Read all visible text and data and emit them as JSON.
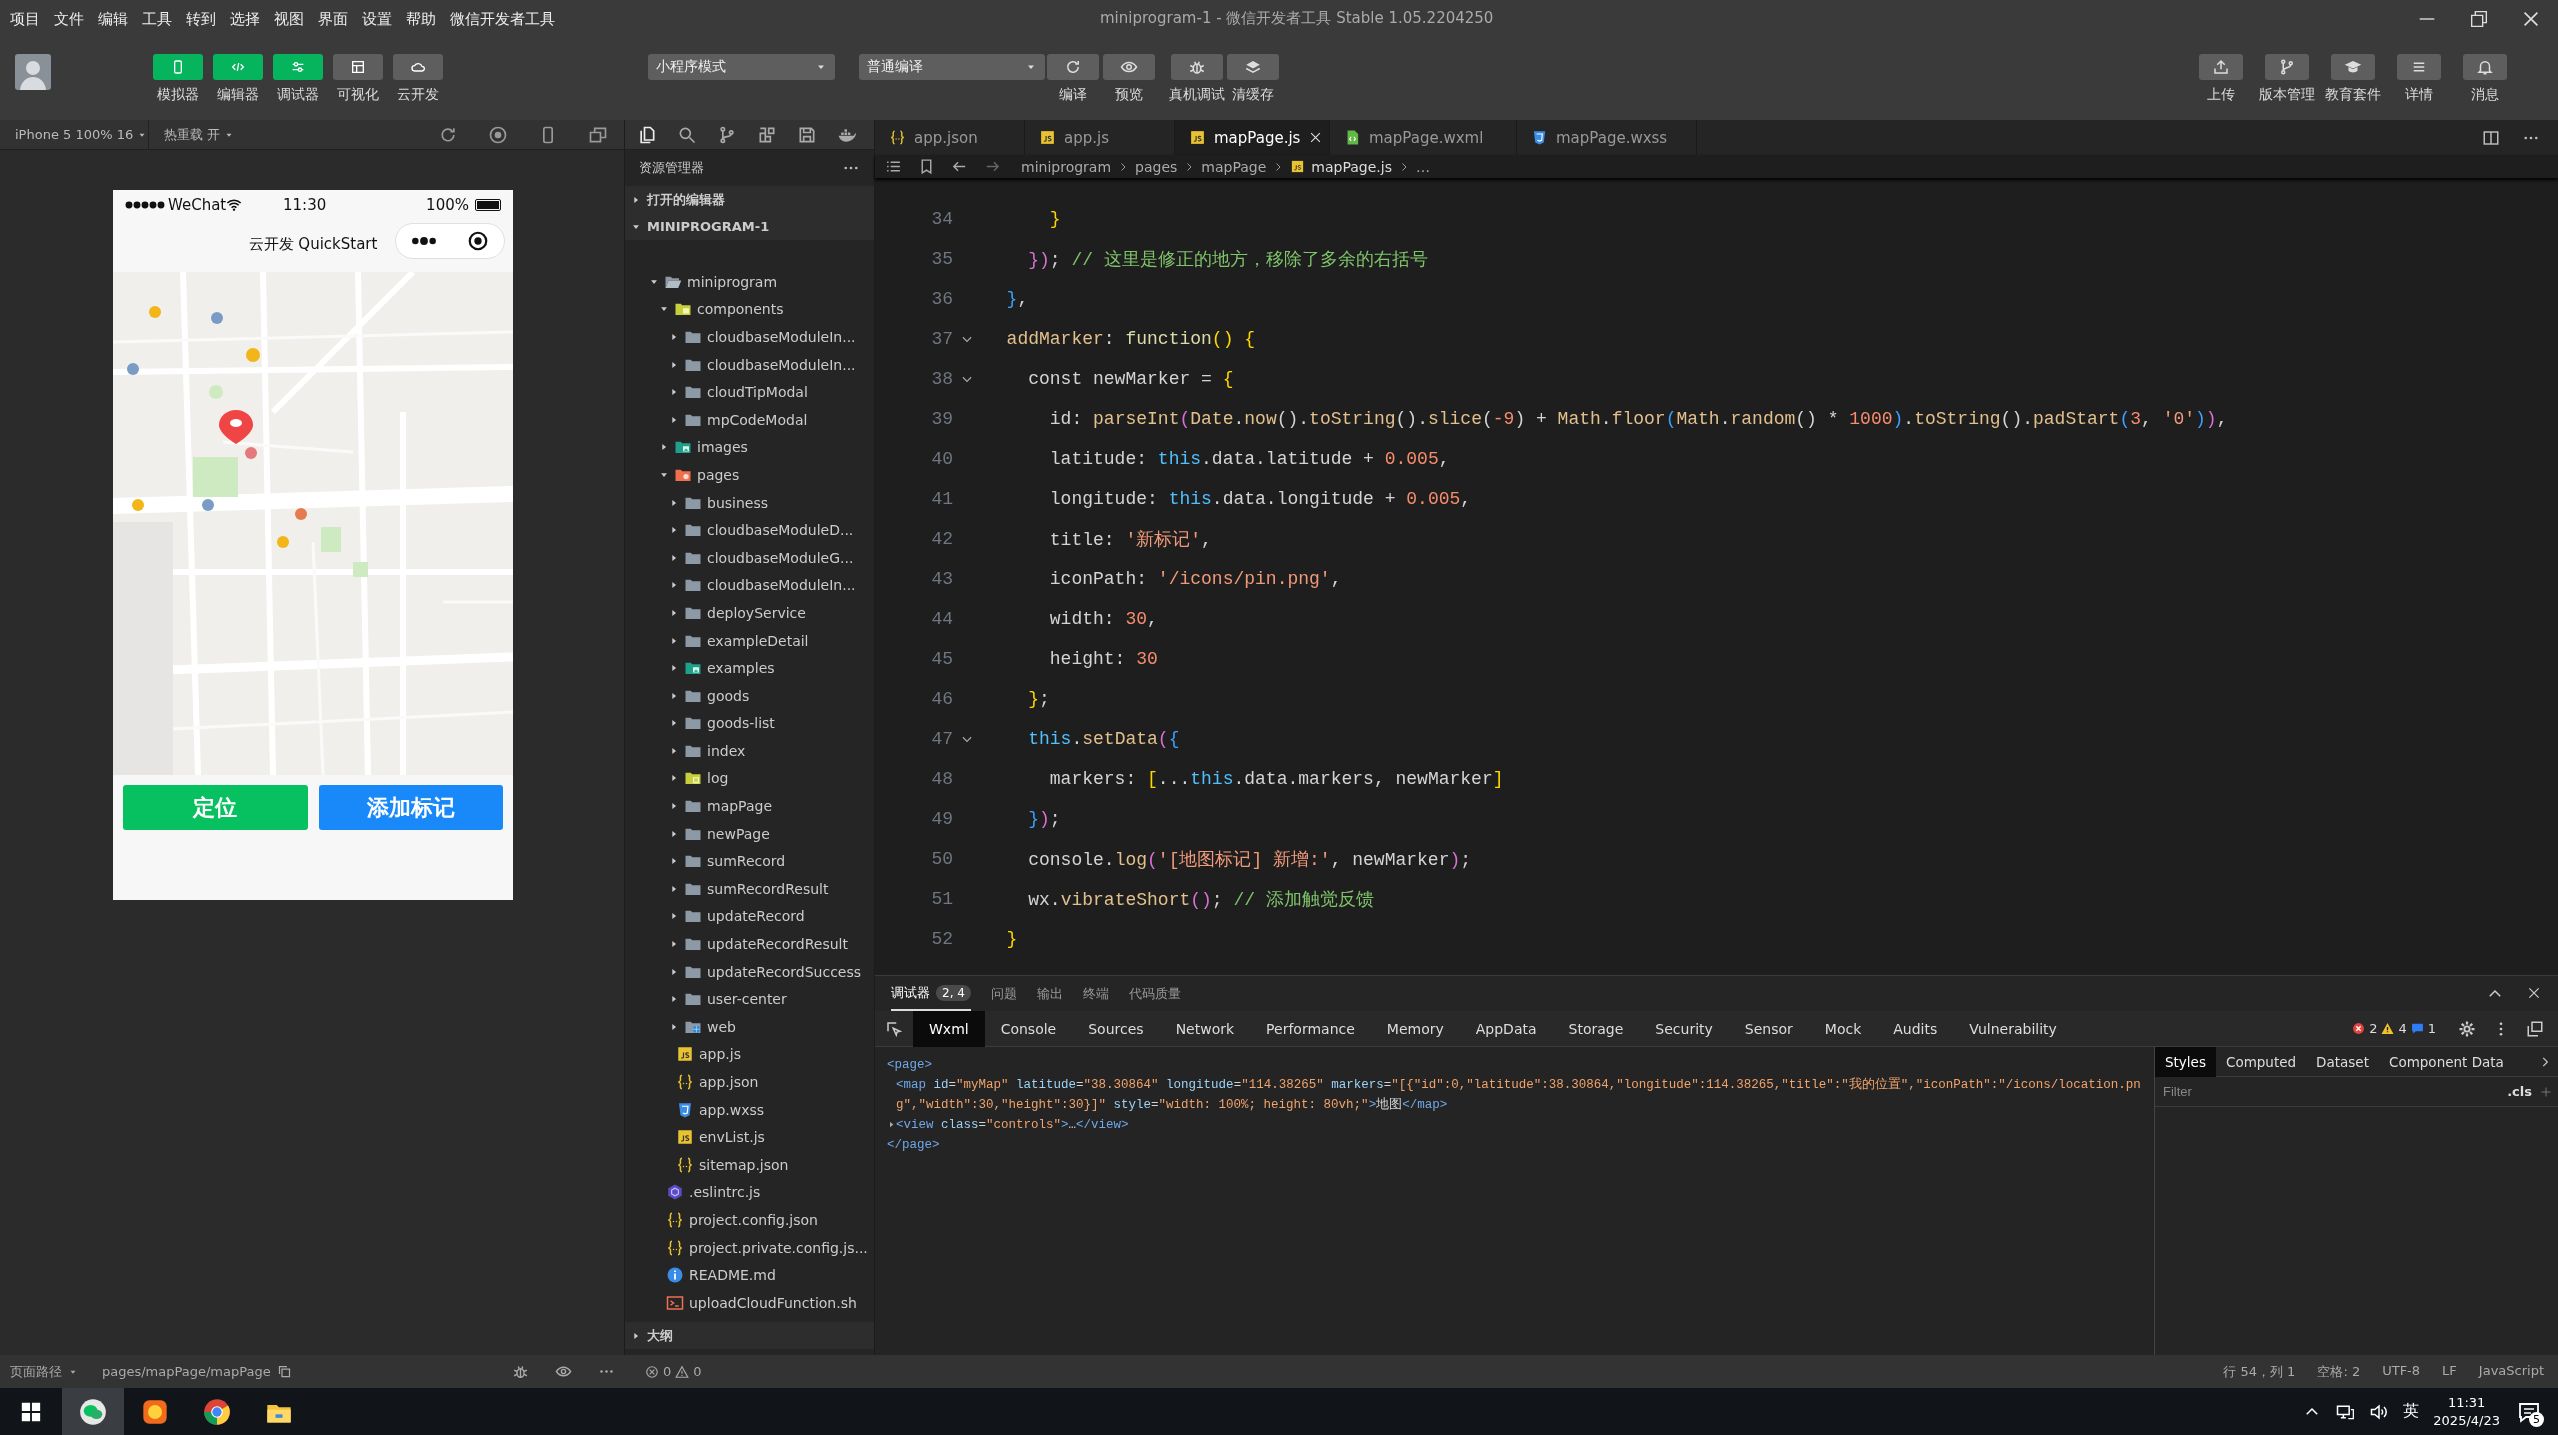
{
  "menu": [
    "项目",
    "文件",
    "编辑",
    "工具",
    "转到",
    "选择",
    "视图",
    "界面",
    "设置",
    "帮助",
    "微信开发者工具"
  ],
  "window": {
    "title": "miniprogram-1 - 微信开发者工具 Stable 1.05.2204250"
  },
  "toolbar": {
    "views": [
      {
        "label": "模拟器",
        "on": true
      },
      {
        "label": "编辑器",
        "on": true
      },
      {
        "label": "调试器",
        "on": true
      },
      {
        "label": "可视化",
        "on": false
      },
      {
        "label": "云开发",
        "on": false
      }
    ],
    "mode_select": "小程序模式",
    "compile_select": "普通编译",
    "actions": [
      {
        "label": "编译"
      },
      {
        "label": "预览"
      },
      {
        "label": "真机调试"
      },
      {
        "label": "清缓存"
      }
    ],
    "right_actions": [
      {
        "label": "上传"
      },
      {
        "label": "版本管理"
      },
      {
        "label": "教育套件"
      },
      {
        "label": "详情"
      },
      {
        "label": "消息"
      }
    ]
  },
  "simulator": {
    "device": "iPhone 5 100% 16",
    "hot_reload": "热重载 开",
    "phone": {
      "carrier": "WeChat",
      "time": "11:30",
      "battery": "100%",
      "nav_title": "云开发 QuickStart",
      "buttons": [
        {
          "label": "定位",
          "color": "#07c160"
        },
        {
          "label": "添加标记",
          "color": "#1989fa"
        }
      ]
    }
  },
  "explorer": {
    "title": "资源管理器",
    "open_editors": {
      "label": "打开的编辑器",
      "expanded": false
    },
    "project": {
      "label": "MINIPROGRAM-1",
      "expanded": true,
      "children": [
        {
          "name": "miniprogram",
          "kind": "folder-open",
          "expanded": true,
          "children": [
            {
              "name": "components",
              "kind": "folder-components",
              "expanded": true,
              "children": [
                {
                  "name": "cloudbaseModuleIn...",
                  "kind": "folder",
                  "expanded": false
                },
                {
                  "name": "cloudbaseModuleIn...",
                  "kind": "folder",
                  "expanded": false
                },
                {
                  "name": "cloudTipModal",
                  "kind": "folder",
                  "expanded": false
                },
                {
                  "name": "mpCodeModal",
                  "kind": "folder",
                  "expanded": false
                }
              ]
            },
            {
              "name": "images",
              "kind": "folder-images",
              "expanded": false
            },
            {
              "name": "pages",
              "kind": "folder-pages",
              "expanded": true,
              "children": [
                {
                  "name": "business",
                  "kind": "folder",
                  "expanded": false
                },
                {
                  "name": "cloudbaseModuleD...",
                  "kind": "folder",
                  "expanded": false
                },
                {
                  "name": "cloudbaseModuleG...",
                  "kind": "folder",
                  "expanded": false
                },
                {
                  "name": "cloudbaseModuleIn...",
                  "kind": "folder",
                  "expanded": false
                },
                {
                  "name": "deployService",
                  "kind": "folder",
                  "expanded": false
                },
                {
                  "name": "exampleDetail",
                  "kind": "folder",
                  "expanded": false
                },
                {
                  "name": "examples",
                  "kind": "folder-images",
                  "expanded": false
                },
                {
                  "name": "goods",
                  "kind": "folder",
                  "expanded": false
                },
                {
                  "name": "goods-list",
                  "kind": "folder",
                  "expanded": false
                },
                {
                  "name": "index",
                  "kind": "folder",
                  "expanded": false
                },
                {
                  "name": "log",
                  "kind": "folder-log",
                  "expanded": false
                },
                {
                  "name": "mapPage",
                  "kind": "folder",
                  "expanded": false
                },
                {
                  "name": "newPage",
                  "kind": "folder",
                  "expanded": false
                },
                {
                  "name": "sumRecord",
                  "kind": "folder",
                  "expanded": false
                },
                {
                  "name": "sumRecordResult",
                  "kind": "folder",
                  "expanded": false
                },
                {
                  "name": "updateRecord",
                  "kind": "folder",
                  "expanded": false
                },
                {
                  "name": "updateRecordResult",
                  "kind": "folder",
                  "expanded": false
                },
                {
                  "name": "updateRecordSuccess",
                  "kind": "folder",
                  "expanded": false
                },
                {
                  "name": "user-center",
                  "kind": "folder",
                  "expanded": false
                },
                {
                  "name": "web",
                  "kind": "folder-web",
                  "expanded": false
                }
              ]
            },
            {
              "name": "app.js",
              "kind": "js"
            },
            {
              "name": "app.json",
              "kind": "json"
            },
            {
              "name": "app.wxss",
              "kind": "wxss"
            },
            {
              "name": "envList.js",
              "kind": "js"
            },
            {
              "name": "sitemap.json",
              "kind": "json"
            }
          ]
        },
        {
          "name": ".eslintrc.js",
          "kind": "eslint"
        },
        {
          "name": "project.config.json",
          "kind": "json"
        },
        {
          "name": "project.private.config.js...",
          "kind": "json"
        },
        {
          "name": "README.md",
          "kind": "info"
        },
        {
          "name": "uploadCloudFunction.sh",
          "kind": "terminal"
        }
      ]
    },
    "outline": {
      "label": "大纲",
      "expanded": false
    }
  },
  "editor": {
    "tabs": [
      {
        "label": "app.json",
        "kind": "json",
        "selected": false
      },
      {
        "label": "app.js",
        "kind": "js",
        "selected": false
      },
      {
        "label": "mapPage.js",
        "kind": "js",
        "selected": true
      },
      {
        "label": "mapPage.wxml",
        "kind": "wxml",
        "selected": false
      },
      {
        "label": "mapPage.wxss",
        "kind": "wxss",
        "selected": false
      }
    ],
    "breadcrumb": [
      {
        "label": "miniprogram",
        "kind": "folder"
      },
      {
        "label": "pages",
        "kind": "folder"
      },
      {
        "label": "mapPage",
        "kind": "folder"
      },
      {
        "label": "mapPage.js",
        "kind": "js"
      },
      {
        "label": "…",
        "kind": "symbol"
      }
    ],
    "lines": [
      {
        "number": "34",
        "fold": false,
        "tokens": [
          {
            "text": "      }",
            "kind": "b1"
          }
        ]
      },
      {
        "number": "35",
        "fold": false,
        "tokens": [
          {
            "text": "    })",
            "kind": "b2"
          },
          {
            "text": "; ",
            "kind": "p"
          },
          {
            "text": "// 这里是修正的地方，移除了多余的右括号",
            "kind": "c"
          }
        ]
      },
      {
        "number": "36",
        "fold": false,
        "tokens": [
          {
            "text": "  }",
            "kind": "b3"
          },
          {
            "text": ",",
            "kind": "p"
          }
        ]
      },
      {
        "number": "37",
        "fold": true,
        "tokens": [
          {
            "text": "  addMarker",
            "kind": "f"
          },
          {
            "text": ": ",
            "kind": "p"
          },
          {
            "text": "function",
            "kind": "k"
          },
          {
            "text": "() {",
            "kind": "b1"
          }
        ]
      },
      {
        "number": "38",
        "fold": true,
        "tokens": [
          {
            "text": "    const newMarker = ",
            "kind": "p"
          },
          {
            "text": "{",
            "kind": "b1"
          }
        ]
      },
      {
        "number": "39",
        "fold": false,
        "tokens": [
          {
            "text": "      id: ",
            "kind": "p"
          },
          {
            "text": "parseInt",
            "kind": "f"
          },
          {
            "text": "(",
            "kind": "b2"
          },
          {
            "text": "Date",
            "kind": "f"
          },
          {
            "text": ".",
            "kind": "p"
          },
          {
            "text": "now",
            "kind": "f"
          },
          {
            "text": "().",
            "kind": "p"
          },
          {
            "text": "toString",
            "kind": "f"
          },
          {
            "text": "().",
            "kind": "p"
          },
          {
            "text": "slice",
            "kind": "f"
          },
          {
            "text": "(",
            "kind": "p"
          },
          {
            "text": "-9",
            "kind": "n"
          },
          {
            "text": ") + ",
            "kind": "p"
          },
          {
            "text": "Math",
            "kind": "f"
          },
          {
            "text": ".",
            "kind": "p"
          },
          {
            "text": "floor",
            "kind": "f"
          },
          {
            "text": "(",
            "kind": "b3"
          },
          {
            "text": "Math",
            "kind": "f"
          },
          {
            "text": ".",
            "kind": "p"
          },
          {
            "text": "random",
            "kind": "f"
          },
          {
            "text": "() * ",
            "kind": "p"
          },
          {
            "text": "1000",
            "kind": "n"
          },
          {
            "text": ")",
            "kind": "b3"
          },
          {
            "text": ".",
            "kind": "p"
          },
          {
            "text": "toString",
            "kind": "f"
          },
          {
            "text": "().",
            "kind": "p"
          },
          {
            "text": "padStart",
            "kind": "f"
          },
          {
            "text": "(",
            "kind": "b3"
          },
          {
            "text": "3",
            "kind": "n"
          },
          {
            "text": ", ",
            "kind": "p"
          },
          {
            "text": "'0'",
            "kind": "s"
          },
          {
            "text": ")",
            "kind": "b3"
          },
          {
            "text": ")",
            "kind": "b2"
          },
          {
            "text": ",",
            "kind": "p"
          }
        ]
      },
      {
        "number": "40",
        "fold": false,
        "tokens": [
          {
            "text": "      latitude: ",
            "kind": "p"
          },
          {
            "text": "this",
            "kind": "t"
          },
          {
            "text": ".data.latitude + ",
            "kind": "p"
          },
          {
            "text": "0.005",
            "kind": "n"
          },
          {
            "text": ",",
            "kind": "p"
          }
        ]
      },
      {
        "number": "41",
        "fold": false,
        "tokens": [
          {
            "text": "      longitude: ",
            "kind": "p"
          },
          {
            "text": "this",
            "kind": "t"
          },
          {
            "text": ".data.longitude + ",
            "kind": "p"
          },
          {
            "text": "0.005",
            "kind": "n"
          },
          {
            "text": ",",
            "kind": "p"
          }
        ]
      },
      {
        "number": "42",
        "fold": false,
        "tokens": [
          {
            "text": "      title: ",
            "kind": "p"
          },
          {
            "text": "'新标记'",
            "kind": "s"
          },
          {
            "text": ",",
            "kind": "p"
          }
        ]
      },
      {
        "number": "43",
        "fold": false,
        "tokens": [
          {
            "text": "      iconPath: ",
            "kind": "p"
          },
          {
            "text": "'/icons/pin.png'",
            "kind": "s"
          },
          {
            "text": ",",
            "kind": "p"
          }
        ]
      },
      {
        "number": "44",
        "fold": false,
        "tokens": [
          {
            "text": "      width: ",
            "kind": "p"
          },
          {
            "text": "30",
            "kind": "n"
          },
          {
            "text": ",",
            "kind": "p"
          }
        ]
      },
      {
        "number": "45",
        "fold": false,
        "tokens": [
          {
            "text": "      height: ",
            "kind": "p"
          },
          {
            "text": "30",
            "kind": "n"
          }
        ]
      },
      {
        "number": "46",
        "fold": false,
        "tokens": [
          {
            "text": "    }",
            "kind": "b1"
          },
          {
            "text": ";",
            "kind": "p"
          }
        ]
      },
      {
        "number": "47",
        "fold": true,
        "tokens": [
          {
            "text": "    this",
            "kind": "t"
          },
          {
            "text": ".",
            "kind": "p"
          },
          {
            "text": "setData",
            "kind": "f"
          },
          {
            "text": "(",
            "kind": "b2"
          },
          {
            "text": "{",
            "kind": "b3"
          }
        ]
      },
      {
        "number": "48",
        "fold": false,
        "tokens": [
          {
            "text": "      markers: ",
            "kind": "p"
          },
          {
            "text": "[",
            "kind": "b1"
          },
          {
            "text": "...",
            "kind": "p"
          },
          {
            "text": "this",
            "kind": "t"
          },
          {
            "text": ".data.markers, newMarker",
            "kind": "p"
          },
          {
            "text": "]",
            "kind": "b1"
          }
        ]
      },
      {
        "number": "49",
        "fold": false,
        "tokens": [
          {
            "text": "    }",
            "kind": "b3"
          },
          {
            "text": ")",
            "kind": "b2"
          },
          {
            "text": ";",
            "kind": "p"
          }
        ]
      },
      {
        "number": "50",
        "fold": false,
        "tokens": [
          {
            "text": "    console.",
            "kind": "p"
          },
          {
            "text": "log",
            "kind": "f"
          },
          {
            "text": "(",
            "kind": "b2"
          },
          {
            "text": "'[地图标记] 新增:'",
            "kind": "s"
          },
          {
            "text": ", newMarker",
            "kind": "p"
          },
          {
            "text": ")",
            "kind": "b2"
          },
          {
            "text": ";",
            "kind": "p"
          }
        ]
      },
      {
        "number": "51",
        "fold": false,
        "tokens": [
          {
            "text": "    wx.",
            "kind": "p"
          },
          {
            "text": "vibrateShort",
            "kind": "f"
          },
          {
            "text": "()",
            "kind": "b2"
          },
          {
            "text": "; ",
            "kind": "p"
          },
          {
            "text": "// 添加触觉反馈",
            "kind": "c"
          }
        ]
      },
      {
        "number": "52",
        "fold": false,
        "tokens": [
          {
            "text": "  }",
            "kind": "b1"
          }
        ]
      }
    ]
  },
  "debugger": {
    "tabs": [
      {
        "label": "调试器",
        "badge": "2, 4",
        "selected": true
      },
      {
        "label": "问题",
        "selected": false
      },
      {
        "label": "输出",
        "selected": false
      },
      {
        "label": "终端",
        "selected": false
      },
      {
        "label": "代码质量",
        "selected": false
      }
    ],
    "devtools_tabs": [
      {
        "label": "Wxml",
        "selected": true
      },
      {
        "label": "Console",
        "selected": false
      },
      {
        "label": "Sources",
        "selected": false
      },
      {
        "label": "Network",
        "selected": false
      },
      {
        "label": "Performance",
        "selected": false
      },
      {
        "label": "Memory",
        "selected": false
      },
      {
        "label": "AppData",
        "selected": false
      },
      {
        "label": "Storage",
        "selected": false
      },
      {
        "label": "Security",
        "selected": false
      },
      {
        "label": "Sensor",
        "selected": false
      },
      {
        "label": "Mock",
        "selected": false
      },
      {
        "label": "Audits",
        "selected": false
      },
      {
        "label": "Vulnerability",
        "selected": false
      }
    ],
    "counts": {
      "errors": "2",
      "warnings": "4",
      "info": "1"
    },
    "wxml": {
      "open": "<page>",
      "close": "</page>",
      "children": [
        {
          "kind": "line",
          "tokens": [
            {
              "text": "<map",
              "kind": "tag"
            },
            {
              "text": " id",
              "kind": "attr"
            },
            {
              "text": "=",
              "kind": "text"
            },
            {
              "text": "\"myMap\"",
              "kind": "val"
            },
            {
              "text": " latitude",
              "kind": "attr"
            },
            {
              "text": "=",
              "kind": "text"
            },
            {
              "text": "\"38.30864\"",
              "kind": "val"
            },
            {
              "text": " longitude",
              "kind": "attr"
            },
            {
              "text": "=",
              "kind": "text"
            },
            {
              "text": "\"114.38265\"",
              "kind": "val"
            },
            {
              "text": " markers",
              "kind": "attr"
            },
            {
              "text": "=",
              "kind": "text"
            },
            {
              "text": "\"[{\"id\":0,\"latitude\":38.30864,\"longitude\":114.38265,\"title\":\"我的位置\",\"iconPath\":\"/icons/location.png\",\"width\":30,\"height\":30}]\"",
              "kind": "val"
            },
            {
              "text": " style",
              "kind": "attr"
            },
            {
              "text": "=",
              "kind": "text"
            },
            {
              "text": "\"width: 100%; height: 80vh;\"",
              "kind": "val"
            },
            {
              "text": ">",
              "kind": "tag"
            },
            {
              "text": "地图",
              "kind": "text"
            },
            {
              "text": "</map>",
              "kind": "tag"
            }
          ]
        },
        {
          "kind": "collapsed",
          "tokens": [
            {
              "text": "<view",
              "kind": "tag"
            },
            {
              "text": " class",
              "kind": "attr"
            },
            {
              "text": "=",
              "kind": "text"
            },
            {
              "text": "\"controls\"",
              "kind": "val"
            },
            {
              "text": ">",
              "kind": "tag"
            },
            {
              "text": "…",
              "kind": "text"
            },
            {
              "text": "</view>",
              "kind": "tag"
            }
          ]
        }
      ]
    },
    "side_tabs": [
      {
        "label": "Styles",
        "selected": true
      },
      {
        "label": "Computed",
        "selected": false
      },
      {
        "label": "Dataset",
        "selected": false
      },
      {
        "label": "Component Data",
        "selected": false
      }
    ],
    "filter_placeholder": "Filter",
    "cls": ".cls"
  },
  "status_bar": {
    "page_path_label": "页面路径",
    "page_path": "pages/mapPage/mapPage",
    "errors": "0",
    "warnings": "0",
    "position": "行 54，列 1",
    "indent": "空格: 2",
    "encoding": "UTF-8",
    "eol": "LF",
    "language": "JavaScript"
  },
  "taskbar": {
    "ime": "英",
    "time": "11:31",
    "date": "2025/4/23",
    "notifications": "5"
  }
}
